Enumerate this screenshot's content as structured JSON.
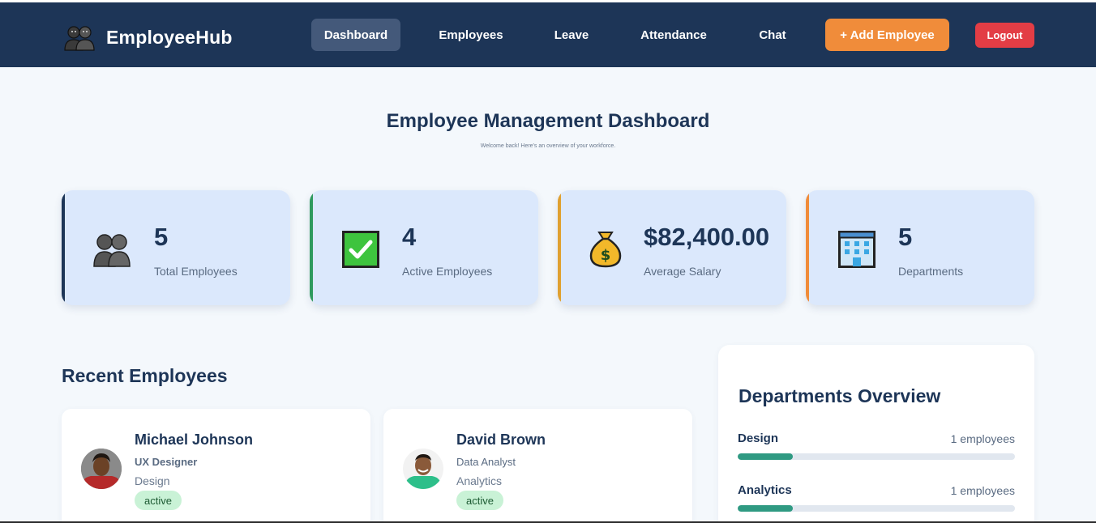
{
  "app": {
    "brand": "EmployeeHub",
    "brand_icon": "people-icon"
  },
  "nav": {
    "items": [
      {
        "label": "Dashboard",
        "active": true
      },
      {
        "label": "Employees",
        "active": false
      },
      {
        "label": "Leave",
        "active": false
      },
      {
        "label": "Attendance",
        "active": false
      },
      {
        "label": "Chat",
        "active": false
      }
    ],
    "add_button": "+ Add Employee",
    "logout_button": "Logout"
  },
  "header": {
    "title": "Employee Management Dashboard",
    "subtitle": "Welcome back! Here's an overview of your workforce."
  },
  "stats": [
    {
      "value": "5",
      "label": "Total Employees",
      "icon": "people-icon",
      "accent": "#1d3557"
    },
    {
      "value": "4",
      "label": "Active Employees",
      "icon": "checkmark-icon",
      "accent": "#2f9a5e"
    },
    {
      "value": "$82,400.00",
      "label": "Average Salary",
      "icon": "money-bag-icon",
      "accent": "#e0a030"
    },
    {
      "value": "5",
      "label": "Departments",
      "icon": "building-icon",
      "accent": "#f08c3a"
    }
  ],
  "recent": {
    "title": "Recent Employees",
    "employees": [
      {
        "name": "Michael Johnson",
        "role": "UX Designer",
        "department": "Design",
        "status": "active"
      },
      {
        "name": "David Brown",
        "role": "Data Analyst",
        "department": "Analytics",
        "status": "active"
      }
    ]
  },
  "departments": {
    "title": "Departments Overview",
    "items": [
      {
        "name": "Design",
        "count": "1 employees",
        "fraction": 0.2
      },
      {
        "name": "Analytics",
        "count": "1 employees",
        "fraction": 0.2
      }
    ]
  },
  "colors": {
    "navbar": "#1d3557",
    "accent_orange": "#f08c3a",
    "logout_red": "#e33d45",
    "progress_green": "#2f9a82",
    "card_bg": "#dbe8fc"
  }
}
